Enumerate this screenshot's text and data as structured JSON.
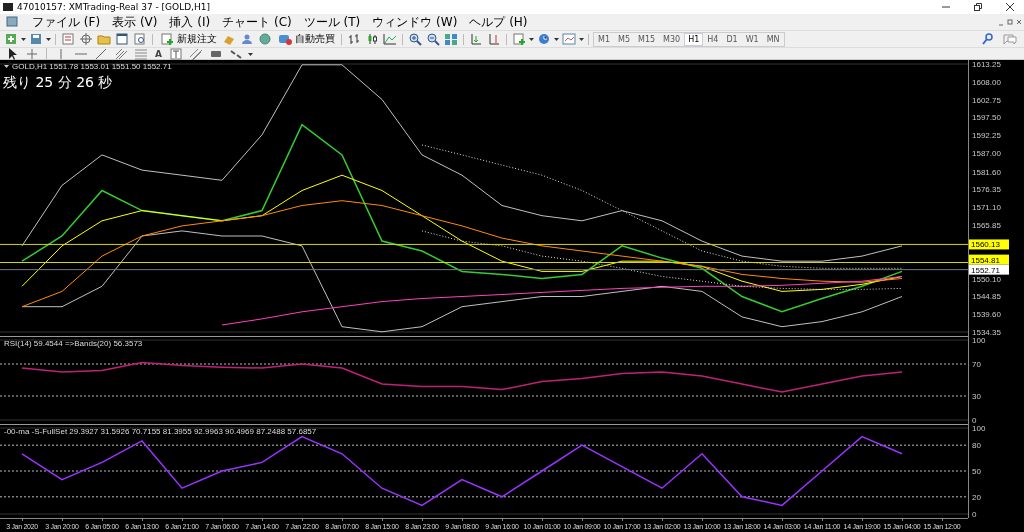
{
  "window": {
    "title": "47010157: XMTrading-Real 37 - [GOLD,H1]"
  },
  "menu": [
    "ファイル (F)",
    "表示 (V)",
    "挿入 (I)",
    "チャート (C)",
    "ツール (T)",
    "ウィンドウ (W)",
    "ヘルプ (H)"
  ],
  "toolbar": {
    "new_order": "新規注文",
    "auto_trading": "自動売買",
    "timeframes": [
      {
        "label": "M1",
        "selected": false
      },
      {
        "label": "M5",
        "selected": false
      },
      {
        "label": "M15",
        "selected": false
      },
      {
        "label": "M30",
        "selected": false
      },
      {
        "label": "H1",
        "selected": true
      },
      {
        "label": "H4",
        "selected": false
      },
      {
        "label": "D1",
        "selected": false
      },
      {
        "label": "W1",
        "selected": false
      },
      {
        "label": "MN",
        "selected": false
      }
    ]
  },
  "drawing_tools": {
    "text_tool": "A"
  },
  "main_chart": {
    "info": "GOLD,H1  1551.78 1553.01 1551.50 1552.71",
    "countdown": "残り 25 分 26 秒",
    "chart_data": {
      "type": "line",
      "ylim": [
        1534.35,
        1613.25
      ],
      "yticks": [
        1534.35,
        {
          "value": 1539.6,
          "label": "1539.60"
        },
        1544.85,
        {
          "value": 1550.1,
          "label": "1550.10"
        },
        1565.85,
        {
          "value": 1571.1,
          "label": "1571.10"
        },
        1576.35,
        {
          "value": 1581.6,
          "label": "1581.60"
        },
        {
          "value": 1587.0,
          "label": "1587.00"
        },
        1592.25,
        {
          "value": 1597.5,
          "label": "1597.50"
        },
        1602.75,
        {
          "value": 1608.0,
          "label": "1608.00"
        },
        1613.25
      ],
      "series": [
        {
          "color": "#33cc33",
          "values": [
            1555.2,
            1562.6,
            1576.0,
            1570.1,
            1568.6,
            1567.1,
            1570.1,
            1595.4,
            1586.5,
            1561.1,
            1558.2,
            1552.2,
            1551.3,
            1550.1,
            1551.3,
            1559.7,
            1556.1,
            1553.1,
            1544.8,
            1540.3,
            1544.2,
            1547.8,
            1552.2,
            null
          ]
        },
        {
          "color": "#c0c0c0",
          "values": [
            1559.7,
            1577.5,
            1586.5,
            1582.0,
            1580.5,
            1579.0,
            1592.4,
            1613.0,
            1613.0,
            1602.8,
            1586.5,
            1580.5,
            1571.6,
            1568.6,
            1567.1,
            1570.1,
            1567.1,
            1561.1,
            1556.7,
            1555.2,
            1555.2,
            1556.7,
            1559.7,
            null
          ]
        },
        {
          "color": "#c0c0c0",
          "values": [
            1541.8,
            1541.8,
            1547.8,
            1562.6,
            1564.1,
            1562.6,
            1562.6,
            1559.7,
            1535.9,
            1534.4,
            1535.9,
            1541.8,
            1543.3,
            1544.8,
            1544.8,
            1546.3,
            1547.8,
            1546.3,
            1538.8,
            1535.9,
            1537.4,
            1540.3,
            1544.8,
            null
          ]
        },
        {
          "color": "#ffff00",
          "values": [
            1547.8,
            1559.7,
            1567.1,
            1570.1,
            1568.6,
            1567.1,
            1568.6,
            1576.0,
            1580.5,
            1576.0,
            1568.6,
            1561.1,
            1555.2,
            1552.2,
            1552.2,
            1555.2,
            1555.2,
            1553.7,
            1549.3,
            1546.3,
            1546.9,
            1548.4,
            1550.7,
            null
          ]
        },
        {
          "color": "#ff8c00",
          "values": [
            1541.8,
            1546.3,
            1556.7,
            1562.6,
            1565.6,
            1567.1,
            1568.6,
            1571.6,
            1573.0,
            1571.6,
            1568.6,
            1565.6,
            1562.0,
            1559.7,
            1558.2,
            1556.7,
            1555.2,
            1553.7,
            1551.3,
            1550.1,
            1549.3,
            1549.0,
            1550.1,
            null
          ]
        },
        {
          "color": "#ff40c0",
          "values": [
            null,
            null,
            null,
            null,
            null,
            1536.4,
            1538.2,
            1540.3,
            1541.8,
            1543.3,
            1544.2,
            1544.8,
            1545.4,
            1546.0,
            1546.6,
            1547.2,
            1547.5,
            1547.8,
            1547.8,
            1548.1,
            1548.7,
            1549.3,
            1550.7,
            null
          ]
        },
        {
          "color": "#e0e0e0",
          "line_style": "dotted",
          "values": [
            null,
            null,
            null,
            null,
            null,
            null,
            null,
            null,
            null,
            null,
            1589.4,
            1586.5,
            1583.5,
            1580.5,
            1576.0,
            1570.1,
            1564.1,
            1558.2,
            1555.2,
            1553.7,
            1553.1,
            1553.1,
            1553.1,
            null
          ]
        },
        {
          "color": "#e0e0e0",
          "line_style": "dotted",
          "values": [
            null,
            null,
            null,
            null,
            null,
            null,
            null,
            null,
            null,
            null,
            1564.1,
            1561.1,
            1559.7,
            1556.7,
            1555.2,
            1553.1,
            1550.7,
            1549.3,
            1547.8,
            1547.2,
            1546.9,
            1546.9,
            1547.2,
            null
          ]
        }
      ],
      "ref_lines": [
        {
          "axis": "y",
          "value": 1560.13,
          "label": "1560.13",
          "color": "#d8d800"
        },
        {
          "axis": "y",
          "value": 1554.81,
          "label": "1554.81",
          "color": "#d8d800"
        },
        {
          "axis": "y",
          "value": 1552.71,
          "label": "1552.71",
          "color": "#707880"
        }
      ]
    }
  },
  "rsi_chart": {
    "info": "RSI(14) 59.4544  =>Bands(20) 56.3573",
    "chart_data": {
      "type": "line",
      "ylim": [
        0,
        100
      ],
      "yticks": [
        0,
        30,
        70,
        100
      ],
      "grid": true,
      "series": [
        {
          "color": "#c0207a",
          "values": [
            65,
            60,
            62,
            72,
            68,
            66,
            65,
            70,
            65,
            45,
            42,
            42,
            38,
            48,
            52,
            58,
            60,
            55,
            45,
            35,
            45,
            55,
            60,
            null
          ]
        }
      ]
    }
  },
  "stoch_chart": {
    "info": "-00-ma -S-FullSet 29.3927 31.5926 70.7155 81.3955 92.9963 90.4969 87.2488 57.6857",
    "chart_data": {
      "type": "line",
      "ylim": [
        0,
        100
      ],
      "yticks": [
        0,
        20,
        50,
        80,
        100
      ],
      "grid": true,
      "categories": [
        "3 Jan 2020",
        "3 Jan 20:00",
        "6 Jan 05:00",
        "6 Jan 13:00",
        "6 Jan 21:00",
        "7 Jan 06:00",
        "7 Jan 14:00",
        "7 Jan 22:00",
        "8 Jan 07:00",
        "8 Jan 15:00",
        "8 Jan 23:00",
        "9 Jan 08:00",
        "9 Jan 16:00",
        "10 Jan 01:00",
        "10 Jan 09:00",
        "10 Jan 17:00",
        "13 Jan 02:00",
        "13 Jan 10:00",
        "13 Jan 18:00",
        "14 Jan 03:00",
        "14 Jan 11:00",
        "14 Jan 19:00",
        "15 Jan 04:00",
        "15 Jan 12:00"
      ],
      "series": [
        {
          "color": "#9933ff",
          "values": [
            70,
            40,
            60,
            85,
            30,
            50,
            60,
            90,
            70,
            30,
            10,
            40,
            20,
            50,
            80,
            55,
            30,
            70,
            20,
            10,
            50,
            90,
            70,
            null
          ]
        }
      ]
    }
  }
}
